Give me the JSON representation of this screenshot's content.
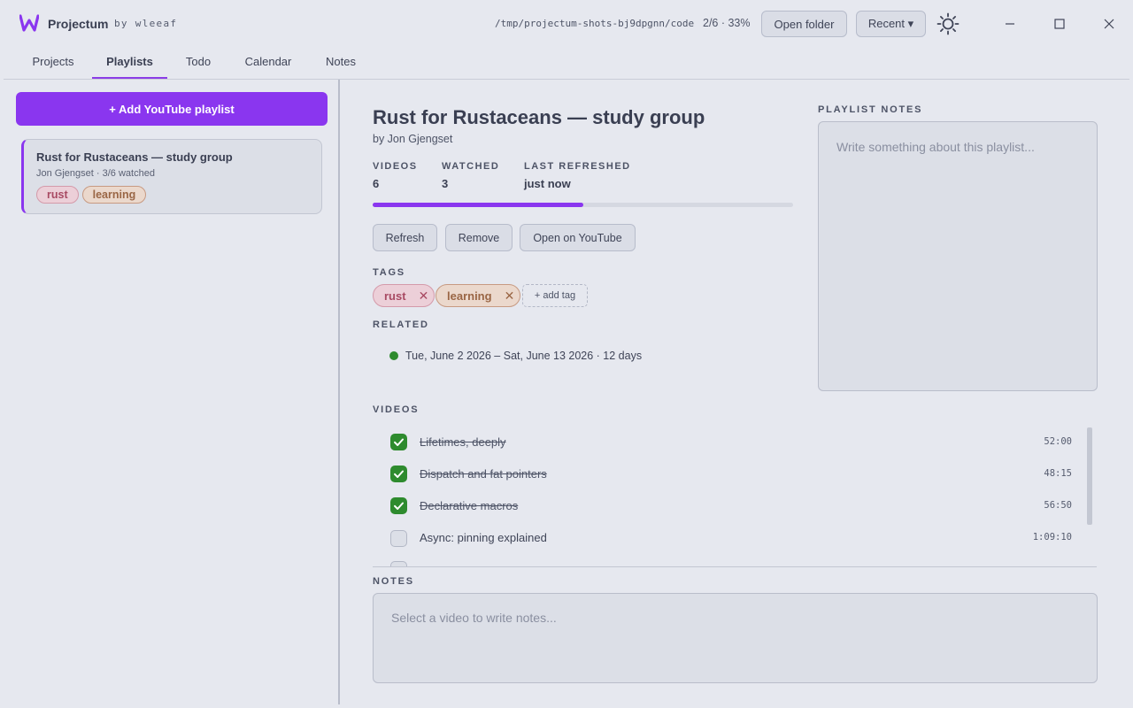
{
  "app": {
    "name": "Projectum",
    "by": "by wleeaf",
    "path": "/tmp/projectum-shots-bj9dpgnn/code",
    "progress": "2/6 · 33%",
    "open_folder": "Open folder",
    "recent": "Recent ▾",
    "brand_color": "#8a36ef"
  },
  "tabs": [
    {
      "label": "Projects"
    },
    {
      "label": "Playlists",
      "active": true
    },
    {
      "label": "Todo"
    },
    {
      "label": "Calendar"
    },
    {
      "label": "Notes"
    }
  ],
  "sidebar": {
    "add_label": "+ Add YouTube playlist",
    "playlists": [
      {
        "title": "Rust for Rustaceans — study group",
        "author": "Jon Gjengset",
        "watched": "3/6 watched",
        "tags": [
          "rust",
          "learning"
        ]
      }
    ]
  },
  "playlist": {
    "title": "Rust for Rustaceans — study group",
    "author": "by Jon Gjengset",
    "stats": {
      "videos_label": "VIDEOS",
      "videos": "6",
      "watched_label": "WATCHED",
      "watched": "3",
      "refreshed_label": "LAST REFRESHED",
      "refreshed": "just now"
    },
    "watched_fraction": 0.5,
    "actions": {
      "refresh": "Refresh",
      "remove": "Remove",
      "open_youtube": "Open on YouTube"
    },
    "tags_label": "TAGS",
    "tags": [
      "rust",
      "learning"
    ],
    "add_tag": "+ add tag",
    "related_label": "RELATED",
    "related": "Tue, June 2 2026 – Sat, June 13 2026 · 12 days",
    "notes_label": "PLAYLIST NOTES",
    "notes_placeholder": "Write something about this playlist..."
  },
  "videos": {
    "label": "VIDEOS",
    "items": [
      {
        "title": "Lifetimes, deeply",
        "duration": "52:00",
        "done": true
      },
      {
        "title": "Dispatch and fat pointers",
        "duration": "48:15",
        "done": true
      },
      {
        "title": "Declarative macros",
        "duration": "56:50",
        "done": true
      },
      {
        "title": "Async: pinning explained",
        "duration": "1:09:10",
        "done": false
      }
    ]
  },
  "notes": {
    "label": "NOTES",
    "placeholder": "Select a video to write notes..."
  }
}
